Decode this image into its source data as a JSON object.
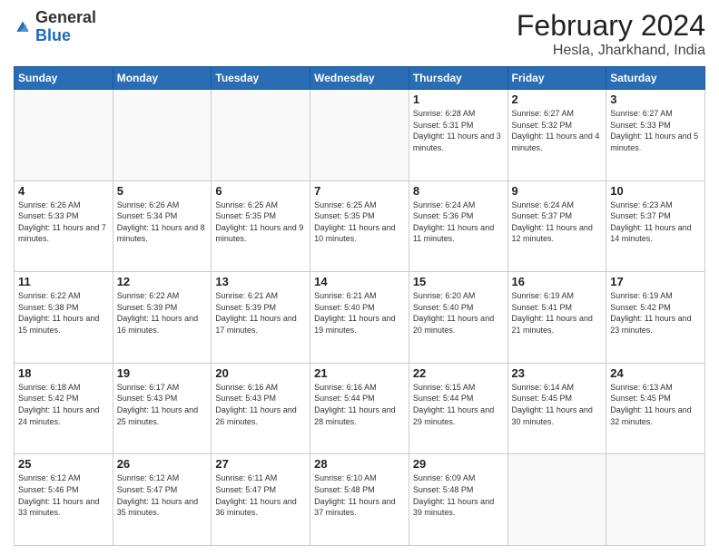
{
  "header": {
    "logo_general": "General",
    "logo_blue": "Blue",
    "month_title": "February 2024",
    "location": "Hesla, Jharkhand, India"
  },
  "days_of_week": [
    "Sunday",
    "Monday",
    "Tuesday",
    "Wednesday",
    "Thursday",
    "Friday",
    "Saturday"
  ],
  "weeks": [
    [
      {
        "day": "",
        "info": ""
      },
      {
        "day": "",
        "info": ""
      },
      {
        "day": "",
        "info": ""
      },
      {
        "day": "",
        "info": ""
      },
      {
        "day": "1",
        "info": "Sunrise: 6:28 AM\nSunset: 5:31 PM\nDaylight: 11 hours and 3 minutes."
      },
      {
        "day": "2",
        "info": "Sunrise: 6:27 AM\nSunset: 5:32 PM\nDaylight: 11 hours and 4 minutes."
      },
      {
        "day": "3",
        "info": "Sunrise: 6:27 AM\nSunset: 5:33 PM\nDaylight: 11 hours and 5 minutes."
      }
    ],
    [
      {
        "day": "4",
        "info": "Sunrise: 6:26 AM\nSunset: 5:33 PM\nDaylight: 11 hours and 7 minutes."
      },
      {
        "day": "5",
        "info": "Sunrise: 6:26 AM\nSunset: 5:34 PM\nDaylight: 11 hours and 8 minutes."
      },
      {
        "day": "6",
        "info": "Sunrise: 6:25 AM\nSunset: 5:35 PM\nDaylight: 11 hours and 9 minutes."
      },
      {
        "day": "7",
        "info": "Sunrise: 6:25 AM\nSunset: 5:35 PM\nDaylight: 11 hours and 10 minutes."
      },
      {
        "day": "8",
        "info": "Sunrise: 6:24 AM\nSunset: 5:36 PM\nDaylight: 11 hours and 11 minutes."
      },
      {
        "day": "9",
        "info": "Sunrise: 6:24 AM\nSunset: 5:37 PM\nDaylight: 11 hours and 12 minutes."
      },
      {
        "day": "10",
        "info": "Sunrise: 6:23 AM\nSunset: 5:37 PM\nDaylight: 11 hours and 14 minutes."
      }
    ],
    [
      {
        "day": "11",
        "info": "Sunrise: 6:22 AM\nSunset: 5:38 PM\nDaylight: 11 hours and 15 minutes."
      },
      {
        "day": "12",
        "info": "Sunrise: 6:22 AM\nSunset: 5:39 PM\nDaylight: 11 hours and 16 minutes."
      },
      {
        "day": "13",
        "info": "Sunrise: 6:21 AM\nSunset: 5:39 PM\nDaylight: 11 hours and 17 minutes."
      },
      {
        "day": "14",
        "info": "Sunrise: 6:21 AM\nSunset: 5:40 PM\nDaylight: 11 hours and 19 minutes."
      },
      {
        "day": "15",
        "info": "Sunrise: 6:20 AM\nSunset: 5:40 PM\nDaylight: 11 hours and 20 minutes."
      },
      {
        "day": "16",
        "info": "Sunrise: 6:19 AM\nSunset: 5:41 PM\nDaylight: 11 hours and 21 minutes."
      },
      {
        "day": "17",
        "info": "Sunrise: 6:19 AM\nSunset: 5:42 PM\nDaylight: 11 hours and 23 minutes."
      }
    ],
    [
      {
        "day": "18",
        "info": "Sunrise: 6:18 AM\nSunset: 5:42 PM\nDaylight: 11 hours and 24 minutes."
      },
      {
        "day": "19",
        "info": "Sunrise: 6:17 AM\nSunset: 5:43 PM\nDaylight: 11 hours and 25 minutes."
      },
      {
        "day": "20",
        "info": "Sunrise: 6:16 AM\nSunset: 5:43 PM\nDaylight: 11 hours and 26 minutes."
      },
      {
        "day": "21",
        "info": "Sunrise: 6:16 AM\nSunset: 5:44 PM\nDaylight: 11 hours and 28 minutes."
      },
      {
        "day": "22",
        "info": "Sunrise: 6:15 AM\nSunset: 5:44 PM\nDaylight: 11 hours and 29 minutes."
      },
      {
        "day": "23",
        "info": "Sunrise: 6:14 AM\nSunset: 5:45 PM\nDaylight: 11 hours and 30 minutes."
      },
      {
        "day": "24",
        "info": "Sunrise: 6:13 AM\nSunset: 5:45 PM\nDaylight: 11 hours and 32 minutes."
      }
    ],
    [
      {
        "day": "25",
        "info": "Sunrise: 6:12 AM\nSunset: 5:46 PM\nDaylight: 11 hours and 33 minutes."
      },
      {
        "day": "26",
        "info": "Sunrise: 6:12 AM\nSunset: 5:47 PM\nDaylight: 11 hours and 35 minutes."
      },
      {
        "day": "27",
        "info": "Sunrise: 6:11 AM\nSunset: 5:47 PM\nDaylight: 11 hours and 36 minutes."
      },
      {
        "day": "28",
        "info": "Sunrise: 6:10 AM\nSunset: 5:48 PM\nDaylight: 11 hours and 37 minutes."
      },
      {
        "day": "29",
        "info": "Sunrise: 6:09 AM\nSunset: 5:48 PM\nDaylight: 11 hours and 39 minutes."
      },
      {
        "day": "",
        "info": ""
      },
      {
        "day": "",
        "info": ""
      }
    ]
  ]
}
